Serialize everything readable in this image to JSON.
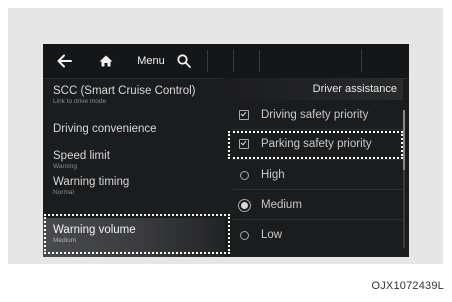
{
  "toolbar": {
    "menu_label": "Menu"
  },
  "left_menu": {
    "items": [
      {
        "label": "SCC (Smart Cruise Control)",
        "sub": "Link to drive mode"
      },
      {
        "label": "Driving convenience",
        "sub": ""
      },
      {
        "label": "Speed limit",
        "sub": "Warning"
      },
      {
        "label": "Warning timing",
        "sub": "Normal"
      },
      {
        "label": "Warning volume",
        "sub": "Medium"
      }
    ],
    "selected_index": 4
  },
  "right_panel": {
    "title": "Driver assistance",
    "options": [
      {
        "label": "Driving safety priority",
        "type": "checkbox",
        "checked": true
      },
      {
        "label": "Parking safety priority",
        "type": "checkbox",
        "checked": true
      },
      {
        "label": "High",
        "type": "radio",
        "selected": false
      },
      {
        "label": "Medium",
        "type": "radio",
        "selected": true
      },
      {
        "label": "Low",
        "type": "radio",
        "selected": false
      }
    ]
  },
  "icons": [
    "back-arrow-icon",
    "home-icon",
    "search-icon",
    "checkbox-icon",
    "radio-icon"
  ],
  "caption": "OJX1072439L"
}
